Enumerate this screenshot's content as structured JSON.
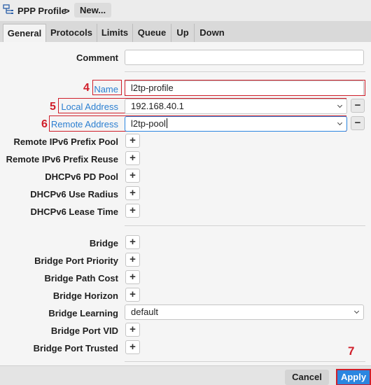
{
  "breadcrumb": {
    "root": "PPP Profile",
    "separator": ">",
    "current": "New..."
  },
  "tabs": [
    {
      "label": "General",
      "active": true
    },
    {
      "label": "Protocols"
    },
    {
      "label": "Limits"
    },
    {
      "label": "Queue"
    },
    {
      "label": "Up"
    },
    {
      "label": "Down"
    }
  ],
  "form": {
    "comment": {
      "label": "Comment",
      "value": ""
    },
    "name": {
      "label": "Name",
      "value": "l2tp-profile",
      "step": "4"
    },
    "local_address": {
      "label": "Local Address",
      "value": "192.168.40.1",
      "step": "5"
    },
    "remote_address": {
      "label": "Remote Address",
      "value": "l2tp-pool",
      "step": "6"
    },
    "ipv6_rows": [
      "Remote IPv6 Prefix Pool",
      "Remote IPv6 Prefix Reuse",
      "DHCPv6 PD Pool",
      "DHCPv6 Use Radius",
      "DHCPv6 Lease Time"
    ],
    "bridge": {
      "label": "Bridge"
    },
    "bridge_port_priority": {
      "label": "Bridge Port Priority"
    },
    "bridge_path_cost": {
      "label": "Bridge Path Cost"
    },
    "bridge_horizon": {
      "label": "Bridge Horizon"
    },
    "bridge_learning": {
      "label": "Bridge Learning",
      "value": "default"
    },
    "bridge_port_vid": {
      "label": "Bridge Port VID"
    },
    "bridge_port_trusted": {
      "label": "Bridge Port Trusted"
    },
    "plus_symbol": "+",
    "minus_symbol": "−"
  },
  "footer": {
    "cancel_label": "Cancel",
    "apply_label": "Apply",
    "apply_step": "7"
  },
  "colors": {
    "accent": "#2b86e0",
    "highlight": "#d01e2a",
    "label_blue": "#2b7fd1"
  }
}
